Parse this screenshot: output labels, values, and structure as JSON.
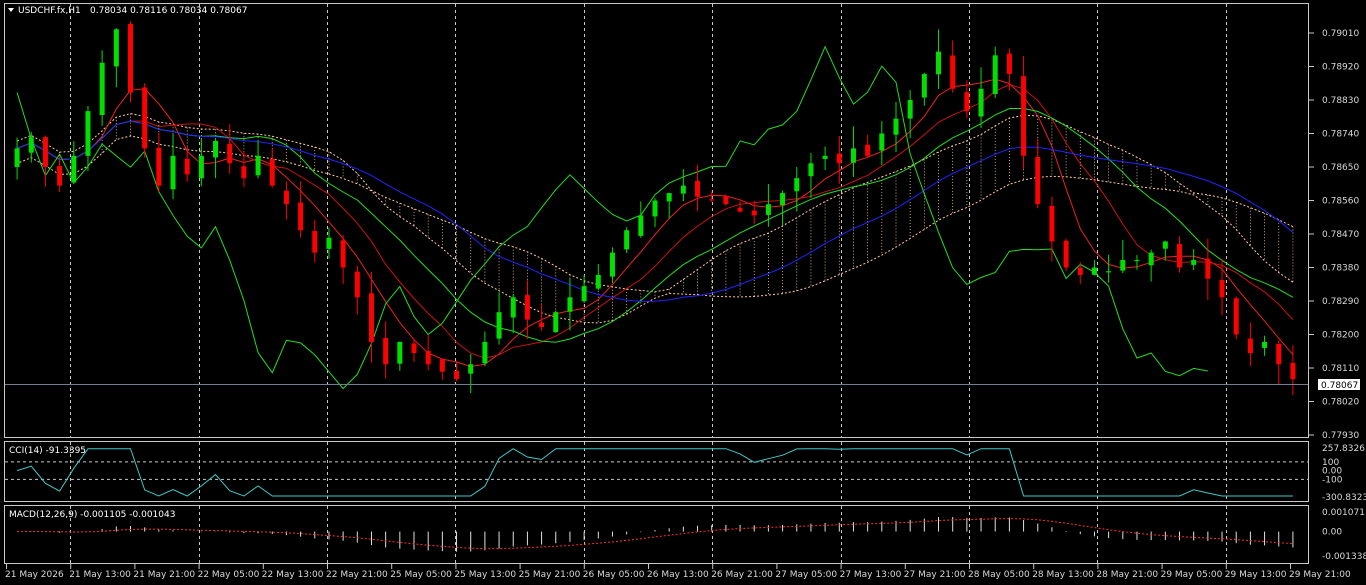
{
  "main": {
    "title": "USDCHF.fx,H1",
    "ohlc": "0.78034 0.78116 0.78034 0.78067",
    "current_price": "0.78067",
    "price_labels": [
      "0.79010",
      "0.78920",
      "0.78830",
      "0.78740",
      "0.78650",
      "0.78560",
      "0.78470",
      "0.78380",
      "0.78290",
      "0.78200",
      "0.78110",
      "0.78020",
      "0.77930"
    ],
    "menu_icon": "triangle-down-icon"
  },
  "cci": {
    "title": "CCI(14) -91.3395",
    "labels": [
      "257.8326",
      "100",
      "0.00",
      "-100",
      "-300.8323"
    ]
  },
  "macd": {
    "title": "MACD(12,26,9) -0.001105 -0.001043",
    "labels": [
      "0.001071",
      "0.00",
      "-0.001338"
    ]
  },
  "time_axis": [
    "21 May 2026",
    "21 May 13:00",
    "21 May 21:00",
    "22 May 05:00",
    "22 May 13:00",
    "22 May 21:00",
    "25 May 05:00",
    "25 May 13:00",
    "25 May 21:00",
    "26 May 05:00",
    "26 May 13:00",
    "26 May 21:00",
    "27 May 05:00",
    "27 May 13:00",
    "27 May 21:00",
    "28 May 05:00",
    "28 May 13:00",
    "28 May 21:00",
    "29 May 05:00",
    "29 May 13:00",
    "29 May 21:00"
  ],
  "colors": {
    "bull": "#00e000",
    "bear": "#ff0000",
    "grid": "#c8c8c8",
    "cci_line": "#44c8c8",
    "macd_signal": "#ff3030",
    "blue": "#2222ff",
    "green_line": "#22dd22",
    "red_line": "#ee2222",
    "cloud": "#ffcc99"
  },
  "chart_data": {
    "type": "candlestick",
    "symbol": "USDCHF.fx",
    "timeframe": "H1",
    "ylim": [
      0.7793,
      0.7906
    ],
    "close_path": [
      0.787,
      0.7873,
      0.7865,
      0.786,
      0.7868,
      0.788,
      0.7893,
      0.7902,
      0.7885,
      0.787,
      0.786,
      0.7868,
      0.7863,
      0.7868,
      0.7872,
      0.7866,
      0.7862,
      0.7868,
      0.786,
      0.7855,
      0.7848,
      0.7842,
      0.7846,
      0.7838,
      0.783,
      0.7818,
      0.7812,
      0.7818,
      0.7815,
      0.7812,
      0.781,
      0.7808,
      0.7812,
      0.7818,
      0.7826,
      0.783,
      0.7824,
      0.7822,
      0.7826,
      0.783,
      0.7833,
      0.7836,
      0.7842,
      0.7848,
      0.7852,
      0.7856,
      0.7858,
      0.786,
      0.7857,
      0.7856,
      0.7855,
      0.7853,
      0.7852,
      0.7855,
      0.7858,
      0.7862,
      0.7866,
      0.7868,
      0.7866,
      0.787,
      0.7868,
      0.7874,
      0.7878,
      0.7883,
      0.789,
      0.7896,
      0.7886,
      0.788,
      0.7886,
      0.7895,
      0.789,
      0.7868,
      0.7855,
      0.7845,
      0.7838,
      0.7836,
      0.7838,
      0.7837,
      0.784,
      0.784,
      0.7842,
      0.7845,
      0.7838,
      0.784,
      0.7835,
      0.783,
      0.782,
      0.7815,
      0.7818,
      0.7812,
      0.7808
    ],
    "cci_last": -91.3395,
    "macd_main": -0.001105,
    "macd_signal": -0.001043
  }
}
